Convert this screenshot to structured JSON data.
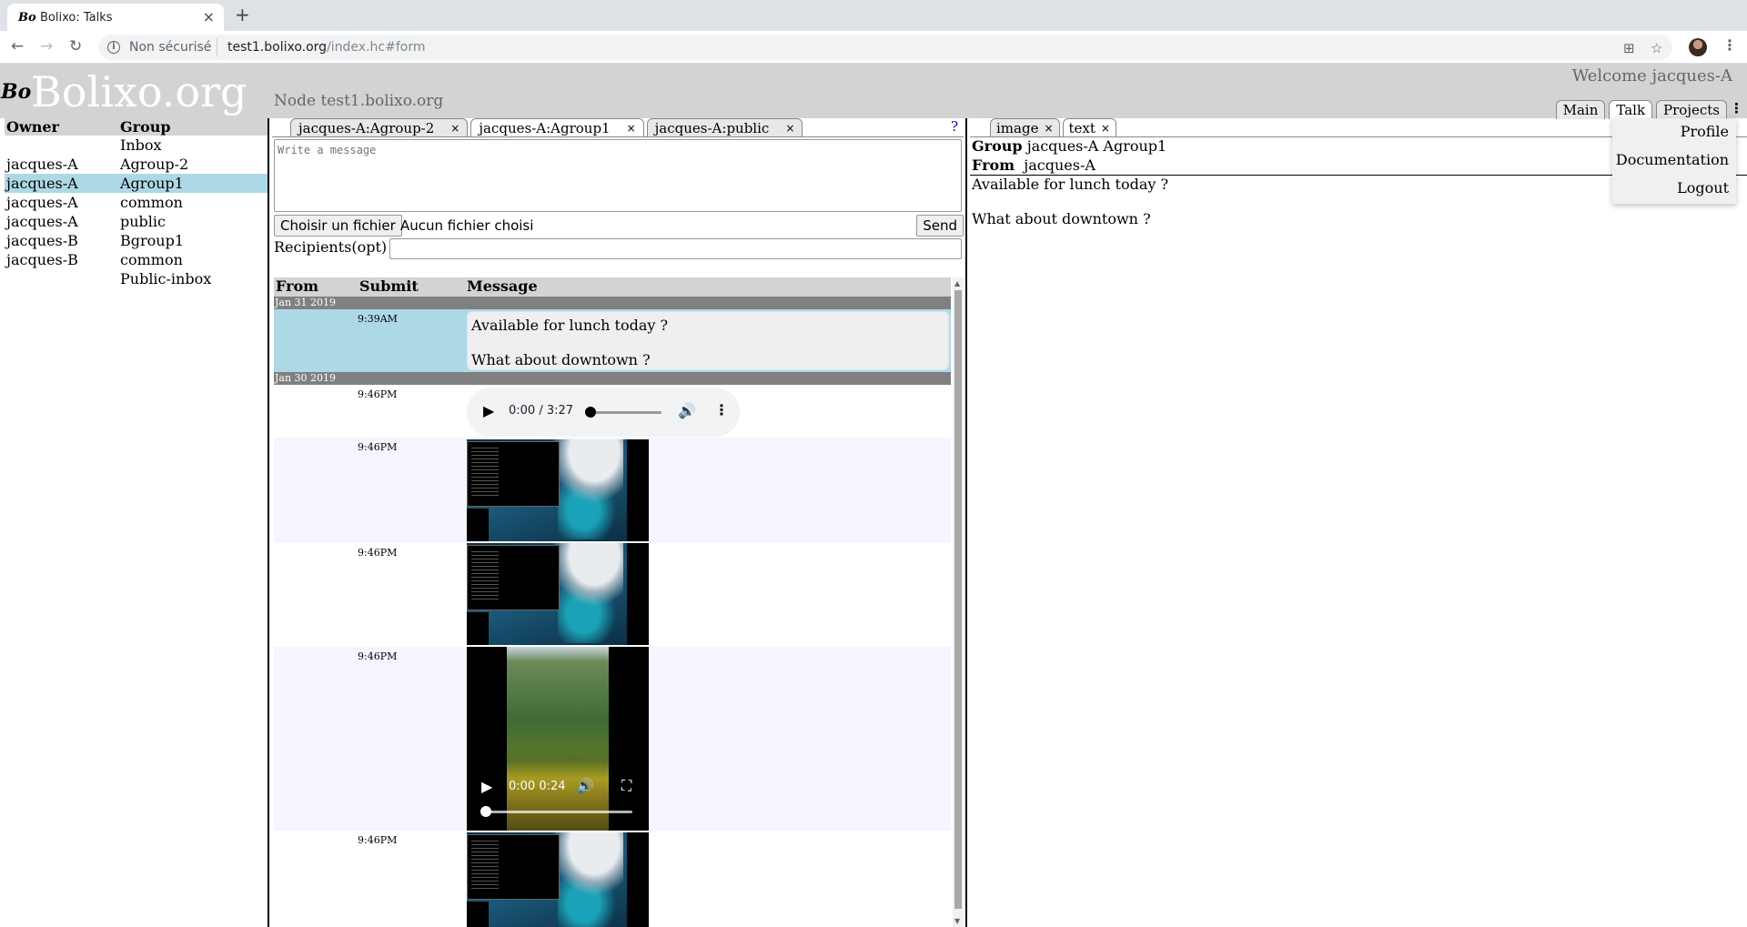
{
  "browser": {
    "tab_title": "Bolixo: Talks",
    "tab_favicon": "Bo",
    "close_glyph": "×",
    "new_tab_glyph": "+",
    "insecure_label": "Non sécurisé",
    "url_host": "test1.bolixo.org",
    "url_path": "/index.hc#form"
  },
  "header": {
    "logo_mark": "Bo",
    "logo_text": "Bolixo.org",
    "node_label": "Node test1.bolixo.org",
    "welcome": "Welcome jacques-A",
    "tabs": [
      "Main",
      "Talk",
      "Projects"
    ],
    "active_tab": "Talk"
  },
  "menu": {
    "items": [
      "Profile",
      "Documentation",
      "Logout"
    ]
  },
  "groups": {
    "col_owner": "Owner",
    "col_group": "Group",
    "rows": [
      {
        "owner": "",
        "group": "Inbox"
      },
      {
        "owner": "jacques-A",
        "group": "Agroup-2"
      },
      {
        "owner": "jacques-A",
        "group": "Agroup1"
      },
      {
        "owner": "jacques-A",
        "group": "common"
      },
      {
        "owner": "jacques-A",
        "group": "public"
      },
      {
        "owner": "jacques-B",
        "group": "Bgroup1"
      },
      {
        "owner": "jacques-B",
        "group": "common"
      },
      {
        "owner": "",
        "group": "Public-inbox"
      }
    ],
    "selected_index": 2
  },
  "compose": {
    "tabs": [
      "jacques-A:Agroup-2",
      "jacques-A:Agroup1",
      "jacques-A:public"
    ],
    "active_tab": "jacques-A:Agroup1",
    "tab_close": "×",
    "help": "?",
    "message_placeholder": "Write a message",
    "file_button": "Choisir un fichier",
    "file_none": "Aucun fichier choisi",
    "send": "Send",
    "recipients_label": "Recipients(opt)"
  },
  "messages": {
    "col_from": "From",
    "col_submit": "Submit",
    "col_message": "Message",
    "date1": "Jan 31 2019",
    "date2": "Jan 30 2019",
    "text_msg": {
      "time": "9:39AM",
      "line1": "Available for lunch today ?",
      "line2": "What about downtown ?"
    },
    "audio": {
      "time": "9:46PM",
      "display": "0:00 / 3:27"
    },
    "img1_time": "9:46PM",
    "img2_time": "9:46PM",
    "video": {
      "time": "9:46PM",
      "display": "0:00 0:24"
    },
    "img3_time": "9:46PM"
  },
  "detail": {
    "tabs": [
      "image",
      "text"
    ],
    "active_tab": "text",
    "tab_close": "×",
    "group_label": "Group",
    "group_value": "jacques-A Agroup1",
    "from_label": "From",
    "from_value": "jacques-A",
    "line1": "Available for lunch today ?",
    "line2": "What about downtown ?"
  },
  "icons": {
    "back": "back-arrow-icon",
    "forward": "forward-arrow-icon",
    "reload": "reload-icon",
    "info": "info-icon",
    "translate": "translate-icon",
    "star": "star-icon",
    "profile": "avatar",
    "menu": "kebab-menu-icon"
  },
  "colors": {
    "selected_row": "#add8e6",
    "header_bg": "#d3d3d3",
    "date_band": "#808080"
  }
}
